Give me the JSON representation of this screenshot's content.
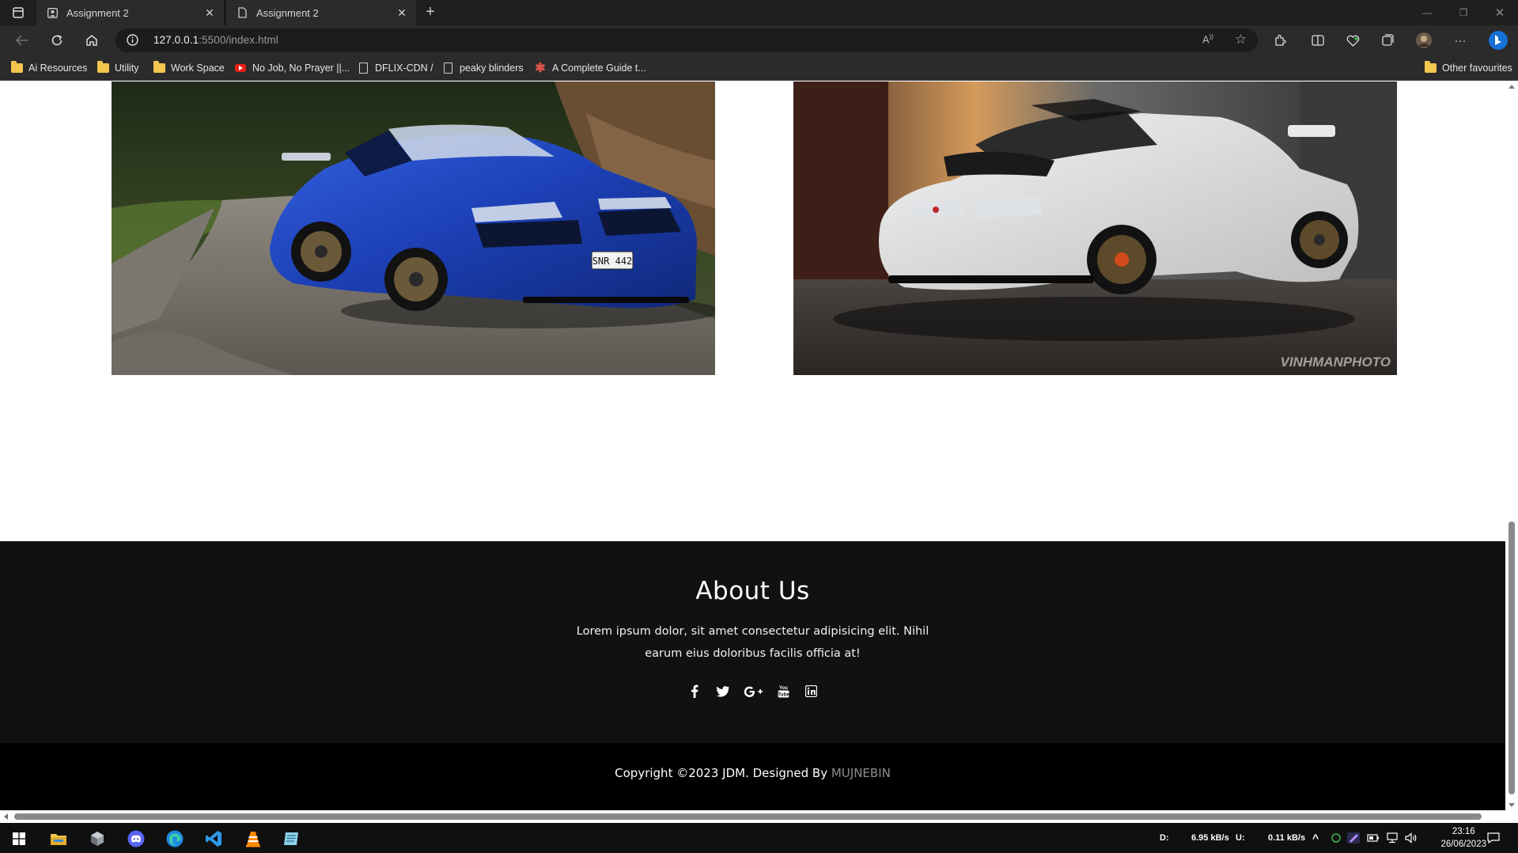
{
  "browser": {
    "tabs": [
      {
        "title": "Assignment 2",
        "active": false
      },
      {
        "title": "Assignment 2",
        "active": true
      }
    ],
    "url_host": "127.0.0.1",
    "url_rest": ":5500/index.html",
    "bookmarks": [
      {
        "label": "Ai Resources",
        "icon": "folder-icon"
      },
      {
        "label": "Utility",
        "icon": "folder-icon"
      },
      {
        "label": "Work Space",
        "icon": "folder-icon"
      },
      {
        "label": "No Job, No Prayer ||...",
        "icon": "youtube-icon"
      },
      {
        "label": "DFLIX-CDN /",
        "icon": "page-icon"
      },
      {
        "label": "peaky blinders",
        "icon": "page-icon"
      },
      {
        "label": "A Complete Guide t...",
        "icon": "asterisk-icon"
      }
    ],
    "other_favourites": "Other favourites"
  },
  "page": {
    "cars": [
      {
        "name": "blue-skyline-r34",
        "color": "#1a3fb0",
        "plate": "SNR 442"
      },
      {
        "name": "white-impreza",
        "color": "#e6e6e6",
        "watermark": "VINHMANPHOTO"
      }
    ],
    "about": {
      "title": "About Us",
      "text": "Lorem ipsum dolor, sit amet consectetur adipisicing elit. Nihil earum eius doloribus facilis officia at!",
      "socials": [
        "facebook-icon",
        "twitter-icon",
        "google-plus-icon",
        "youtube-icon",
        "linkedin-icon"
      ]
    },
    "footer": {
      "copyright": "Copyright ©2023 JDM. Designed By ",
      "designer": "MUJNEBIN"
    }
  },
  "taskbar": {
    "download_label": "D:",
    "download_speed": "6.95 kB/s",
    "upload_label": "U:",
    "upload_speed": "0.11 kB/s",
    "time": "23:16",
    "date": "26/06/2023"
  }
}
